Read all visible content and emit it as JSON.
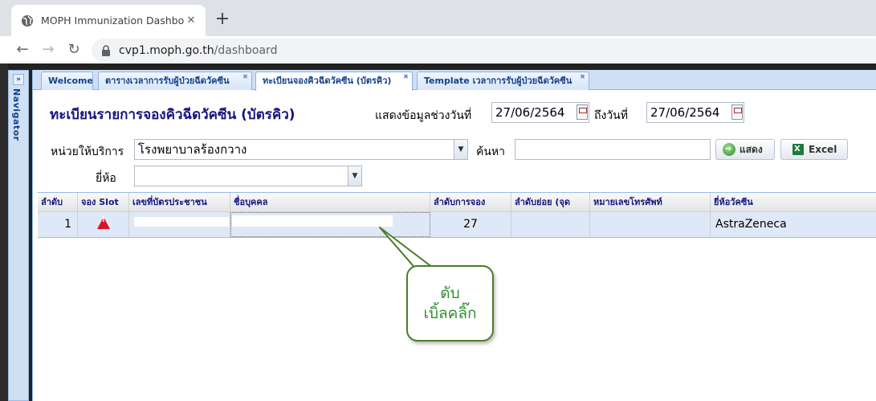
{
  "browser": {
    "tab_title": "MOPH Immunization Dashboard",
    "tab_close": "✕",
    "new_tab": "+",
    "url_host": "cvp1.moph.go.th",
    "url_path": "/dashboard"
  },
  "sidebar": {
    "label": "Navigator",
    "expand": "»"
  },
  "tabs": [
    {
      "label": "Welcome"
    },
    {
      "label": "ตารางเวลาการรับผู้ป่วยฉีดวัคซีน"
    },
    {
      "label": "ทะเบียนจองคิวฉีดวัคซีน (บัตรคิว)"
    },
    {
      "label": "Template เวลาการรับผู้ป่วยฉีดวัคซีน"
    }
  ],
  "form": {
    "title": "ทะเบียนรายการจองคิวฉีดวัคซีน (บัตรคิว)",
    "date_range_label": "แสดงข้อมูลช่วงวันที่",
    "date_from": "27/06/2564",
    "date_to_label": "ถึงวันที่",
    "date_to": "27/06/2564",
    "unit_label": "หน่วยให้บริการ",
    "unit_value": "โรงพยาบาลร้องกวาง",
    "search_label": "ค้นหา",
    "search_value": "",
    "brand_label": "ยี่ห้อ",
    "brand_value": "",
    "show_button": "แสดง",
    "excel_button": "Excel"
  },
  "grid": {
    "columns": [
      "ลำดับ",
      "จอง Slot",
      "เลขที่บัตรประชาชน",
      "ชื่อบุคคล",
      "ลำดับการจอง",
      "ลำดับย่อย (จุด",
      "หมายเลขโทรศัพท์",
      "ยี่ห้อวัคซีน"
    ],
    "rows": [
      {
        "no": "1",
        "slot_icon": "warning-icon",
        "cid": "",
        "name": "",
        "booking_no": "27",
        "sub_no": "",
        "phone": "",
        "brand": "AstraZeneca"
      }
    ]
  },
  "callout": {
    "line1": "ดับ",
    "line2": "เบิ้ลคลิ๊ก"
  },
  "colors": {
    "title": "#15157f",
    "selected_row": "#dfe8f6",
    "callout_border": "#4b7d27",
    "callout_text": "#2f8f2f",
    "warning": "#d9132a"
  }
}
